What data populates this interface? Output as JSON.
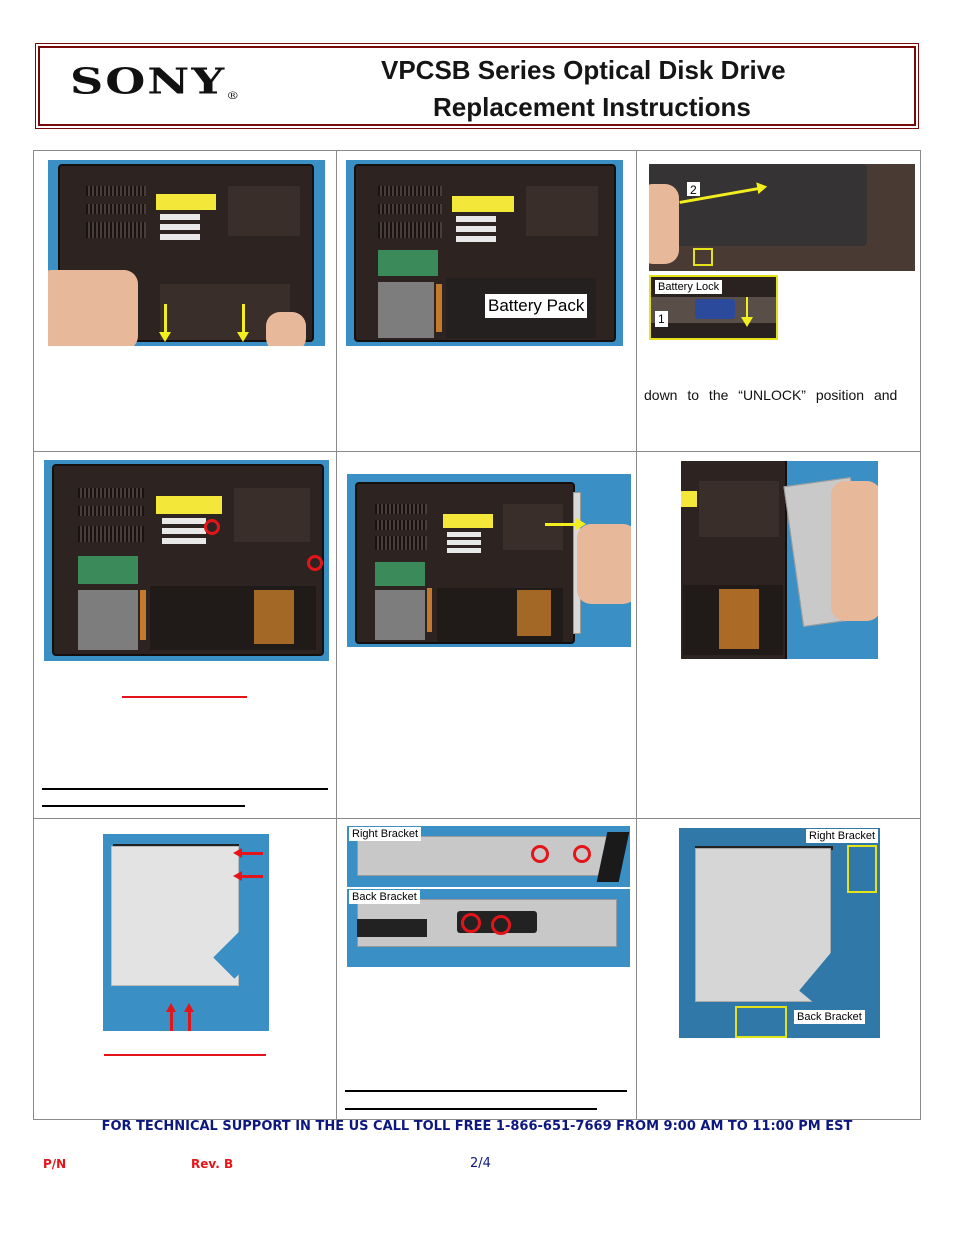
{
  "header": {
    "brand": "SONY",
    "registered_mark": "®",
    "title_line1": "VPCSB Series Optical Disk Drive",
    "title_line2": "Replacement Instructions"
  },
  "steps": [
    {
      "row": 1,
      "col": 1,
      "image": "laptop-bottom-hands-sliding-cover",
      "annotations": [
        "yellow-arrow-down",
        "yellow-arrow-down"
      ],
      "text": ""
    },
    {
      "row": 1,
      "col": 2,
      "image": "laptop-bottom-battery-exposed",
      "callout": "Battery Pack",
      "text": ""
    },
    {
      "row": 1,
      "col": 3,
      "image": "battery-lock-release",
      "callouts": [
        "2",
        "Battery Lock",
        "1"
      ],
      "text": "down to the “UNLOCK” position and"
    },
    {
      "row": 2,
      "col": 1,
      "image": "laptop-bottom-two-screws-circled",
      "annotations": [
        "red-circle",
        "red-circle"
      ],
      "text": ""
    },
    {
      "row": 2,
      "col": 2,
      "image": "push-optical-drive-out",
      "annotations": [
        "yellow-arrow-right"
      ],
      "text": ""
    },
    {
      "row": 2,
      "col": 3,
      "image": "optical-drive-removed",
      "text": ""
    },
    {
      "row": 3,
      "col": 1,
      "image": "optical-drive-bracket-arrows",
      "annotations": [
        "red-arrow",
        "red-arrow",
        "red-arrow",
        "red-arrow"
      ],
      "text": ""
    },
    {
      "row": 3,
      "col": 2,
      "image": "bracket-screws-circled",
      "callouts": [
        "Right Bracket",
        "Back Bracket"
      ],
      "text": ""
    },
    {
      "row": 3,
      "col": 3,
      "image": "brackets-removed",
      "callouts": [
        "Right Bracket",
        "Back Bracket"
      ],
      "text": ""
    }
  ],
  "footer": {
    "support": "FOR TECHNICAL SUPPORT IN THE US CALL TOLL FREE 1-866-651-7669 FROM 9:00 AM TO 11:00 PM EST",
    "pn_label": "P/N",
    "rev_label": "Rev. B",
    "page": "2/4"
  },
  "colors": {
    "header_border": "#7a0a0a",
    "support_text": "#0d1780",
    "footer_red": "#e3151a",
    "callout_yellow": "#f2ee20",
    "circle_red": "#e3151a"
  }
}
